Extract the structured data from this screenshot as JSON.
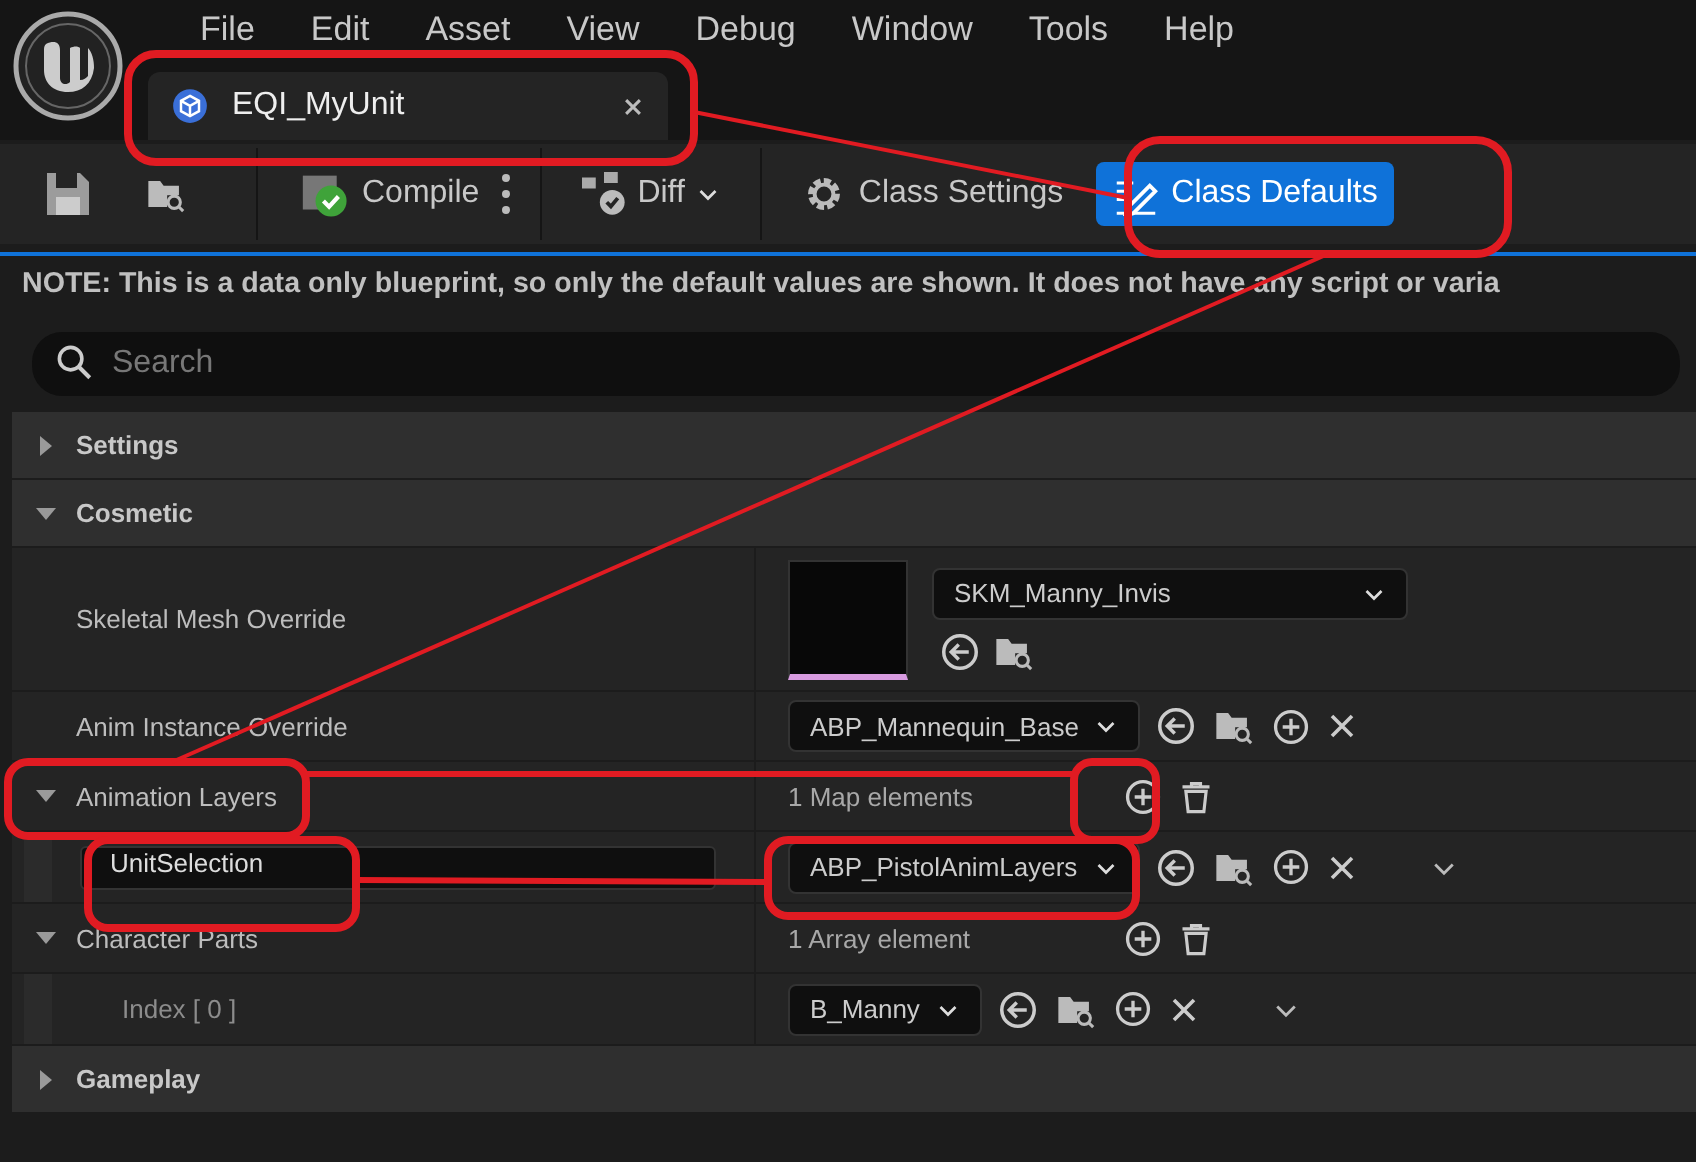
{
  "menu": [
    "File",
    "Edit",
    "Asset",
    "View",
    "Debug",
    "Window",
    "Tools",
    "Help"
  ],
  "tab": {
    "title": "EQI_MyUnit"
  },
  "toolbar": {
    "compile": "Compile",
    "diff": "Diff",
    "modes": [
      {
        "label": "Class Settings",
        "selected": false
      },
      {
        "label": "Class Defaults",
        "selected": true
      }
    ]
  },
  "details": {
    "note": "NOTE: This is a data only blueprint, so only the default values are shown.  It does not have any script or varia",
    "search": {
      "placeholder": "Search"
    },
    "sections": [
      {
        "title": "Settings",
        "expanded": false
      },
      {
        "title": "Cosmetic",
        "expanded": true,
        "properties": [
          {
            "label": "Skeletal Mesh Override",
            "kind": "asset",
            "value": "SKM_Manny_Invis"
          },
          {
            "label": "Anim Instance Override",
            "kind": "class",
            "value": "ABP_Mannequin_Base"
          },
          {
            "label": "Animation Layers",
            "kind": "map",
            "expanded": true,
            "summary": "1 Map elements",
            "children": [
              {
                "key": "UnitSelection",
                "value": "ABP_PistolAnimLayers"
              }
            ]
          },
          {
            "label": "Character Parts",
            "kind": "array",
            "expanded": true,
            "summary": "1 Array element",
            "children": [
              {
                "label": "Index [ 0 ]",
                "value": "B_Manny"
              }
            ]
          }
        ]
      },
      {
        "title": "Gameplay",
        "expanded": false
      }
    ]
  }
}
